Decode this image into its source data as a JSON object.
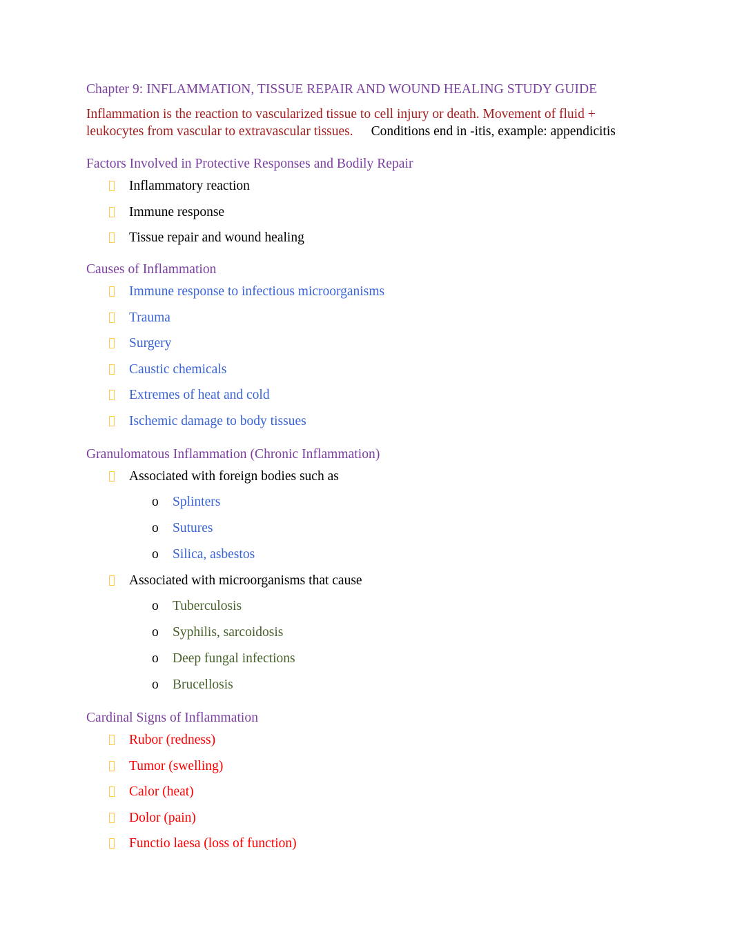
{
  "document": {
    "title": "Chapter 9: INFLAMMATION, TISSUE REPAIR AND WOUND HEALING STUDY GUIDE",
    "intro": {
      "main": "Inflammation is the reaction to vascularized tissue to cell injury or death. Movement of fluid + leukocytes from vascular to extravascular tissues.",
      "tail": "Conditions end in -itis, example: appendicitis"
    },
    "colors": {
      "heading_purple": "#7B3FA0",
      "intro_dark_red": "#A32020",
      "body_black": "#000000",
      "blue": "#3A64D8",
      "green": "#48622B",
      "red": "#FF0000",
      "bullet_gold": "#FFC845",
      "page_background": "#FFFFFF"
    },
    "markers": {
      "level1": "missing-glyph-box",
      "level2": "o"
    },
    "sections": [
      {
        "heading": "Factors Involved in Protective Responses and Bodily Repair",
        "items": [
          {
            "text": "Inflammatory reaction",
            "color": "black"
          },
          {
            "text": "Immune response",
            "color": "black"
          },
          {
            "text": "Tissue repair and wound healing",
            "color": "black"
          }
        ]
      },
      {
        "heading": "Causes of Inflammation",
        "items": [
          {
            "text": "Immune response to infectious microorganisms",
            "color": "blue"
          },
          {
            "text": "Trauma",
            "color": "blue"
          },
          {
            "text": "Surgery",
            "color": "blue"
          },
          {
            "text": "Caustic chemicals",
            "color": "blue"
          },
          {
            "text": "Extremes of heat and cold",
            "color": "blue"
          },
          {
            "text": "Ischemic damage to body tissues",
            "color": "blue"
          }
        ]
      },
      {
        "heading": "Granulomatous Inflammation (Chronic Inflammation)",
        "groups": [
          {
            "lead": "Associated with foreign bodies such as",
            "lead_color": "black",
            "sub": [
              {
                "text": "Splinters",
                "color": "blue"
              },
              {
                "text": "Sutures",
                "color": "blue"
              },
              {
                "text": "Silica, asbestos",
                "color": "blue"
              }
            ]
          },
          {
            "lead": "Associated with microorganisms that cause",
            "lead_color": "black",
            "sub": [
              {
                "text": "Tuberculosis",
                "color": "green"
              },
              {
                "text": "Syphilis, sarcoidosis",
                "color": "green"
              },
              {
                "text": "Deep fungal infections",
                "color": "green"
              },
              {
                "text": "Brucellosis",
                "color": "green"
              }
            ]
          }
        ]
      },
      {
        "heading": "Cardinal Signs of Inflammation",
        "items": [
          {
            "text": "Rubor (redness)",
            "color": "red"
          },
          {
            "text": "Tumor (swelling)",
            "color": "red"
          },
          {
            "text": "Calor (heat)",
            "color": "red"
          },
          {
            "text": "Dolor (pain)",
            "color": "red"
          },
          {
            "text": "Functio laesa (loss of function)",
            "color": "red"
          }
        ]
      }
    ]
  }
}
